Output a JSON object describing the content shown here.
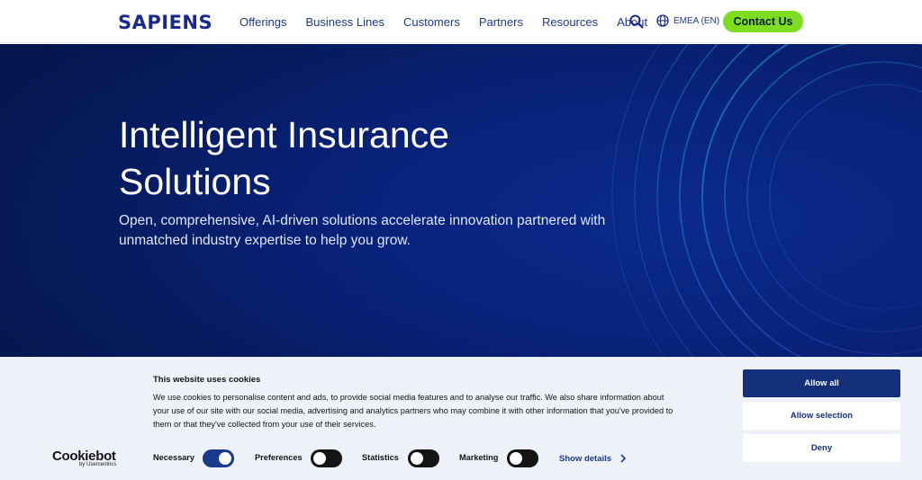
{
  "header": {
    "logo_text": "SAPIENS",
    "nav": [
      "Offerings",
      "Business Lines",
      "Customers",
      "Partners",
      "Resources",
      "About"
    ],
    "locale": "EMEA (EN)",
    "contact_label": "Contact Us"
  },
  "hero": {
    "title_line1": "Intelligent Insurance",
    "title_line2": "Solutions",
    "subtitle_line1": "Open, comprehensive, AI-driven solutions accelerate innovation partnered with",
    "subtitle_line2": "unmatched industry expertise to help you grow."
  },
  "cookie": {
    "brand_main": "Cookiebot",
    "brand_sub": "by Usercentrics",
    "title": "This website uses cookies",
    "text_line1": "We use cookies to personalise content and ads, to provide social media features and to analyse our traffic. We also share information about",
    "text_line2": "your use of our site with our social media, advertising and analytics partners who may combine it with other information that you've provided to",
    "text_line3": "them or that they've collected from your use of their services.",
    "consents": [
      {
        "label": "Necessary",
        "state": "on"
      },
      {
        "label": "Preferences",
        "state": "off"
      },
      {
        "label": "Statistics",
        "state": "off"
      },
      {
        "label": "Marketing",
        "state": "off"
      }
    ],
    "show_details": "Show details",
    "allow_all": "Allow all",
    "allow_selection": "Allow selection",
    "deny": "Deny"
  },
  "colors": {
    "brand_blue": "#1a2a8c",
    "accent_green": "#7ddd1f",
    "hero_bg": "#08227a",
    "cookie_bg": "#eef2f8"
  }
}
